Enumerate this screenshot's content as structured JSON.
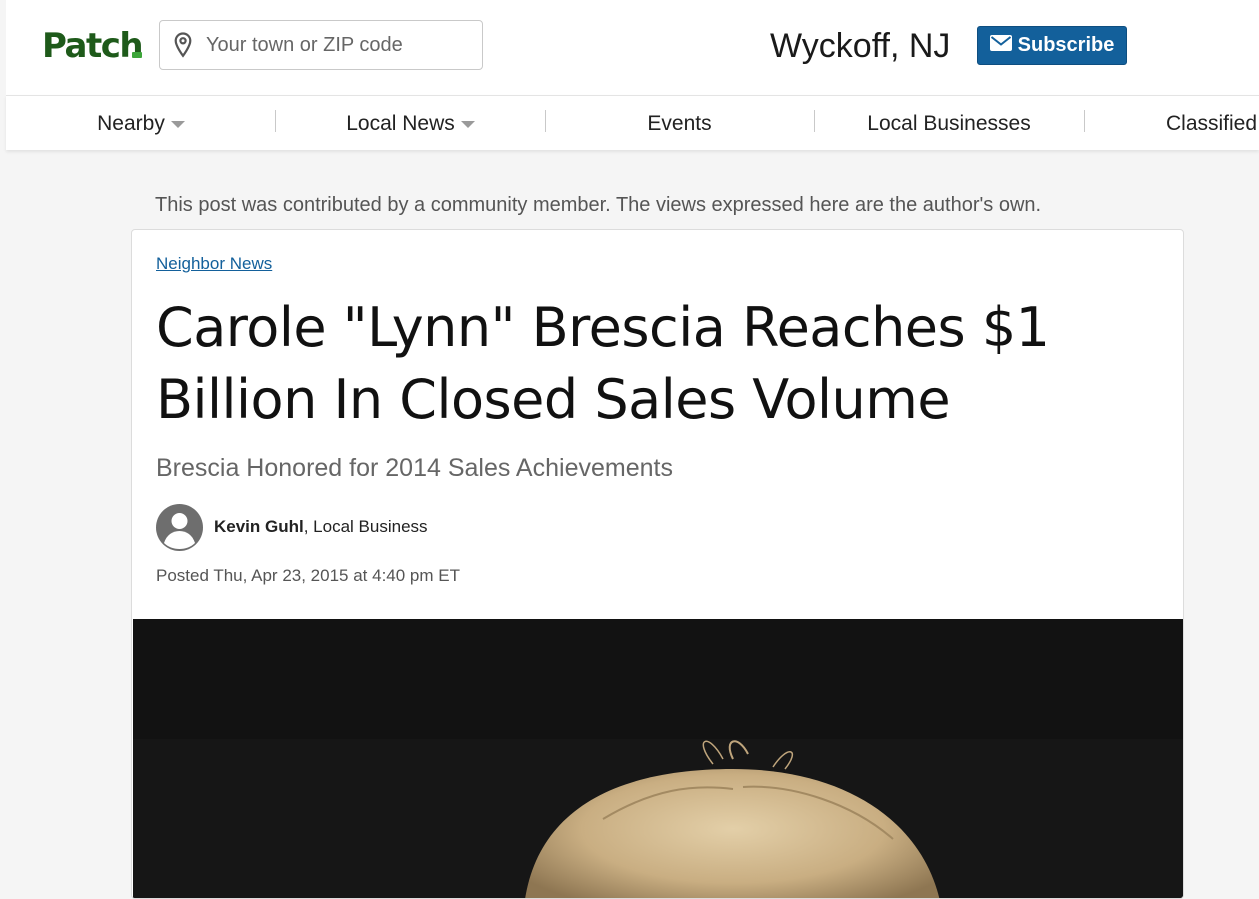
{
  "header": {
    "logo_text": "Patch",
    "search_placeholder": "Your town or ZIP code",
    "town": "Wyckoff, NJ",
    "subscribe_label": "Subscribe"
  },
  "nav": {
    "items": [
      {
        "label": "Nearby",
        "has_dropdown": true
      },
      {
        "label": "Local News",
        "has_dropdown": true
      },
      {
        "label": "Events",
        "has_dropdown": false
      },
      {
        "label": "Local Businesses",
        "has_dropdown": false
      },
      {
        "label": "Classified",
        "has_dropdown": false
      }
    ]
  },
  "article": {
    "disclaimer": "This post was contributed by a community member. The views expressed here are the author's own.",
    "category": "Neighbor News",
    "title": "Carole \"Lynn\" Brescia Reaches $1 Billion In Closed Sales Volume",
    "subtitle": "Brescia Honored for 2014 Sales Achievements",
    "author": "Kevin Guhl",
    "author_role": ", Local Business",
    "posted": "Posted Thu, Apr 23, 2015 at 4:40 pm ET"
  },
  "colors": {
    "brand_green": "#1e5a1a",
    "accent_blue": "#13609b",
    "background": "#f5f5f5"
  },
  "icons": {
    "search": "map-pin-icon",
    "subscribe": "envelope-icon",
    "avatar": "user-silhouette-icon"
  }
}
